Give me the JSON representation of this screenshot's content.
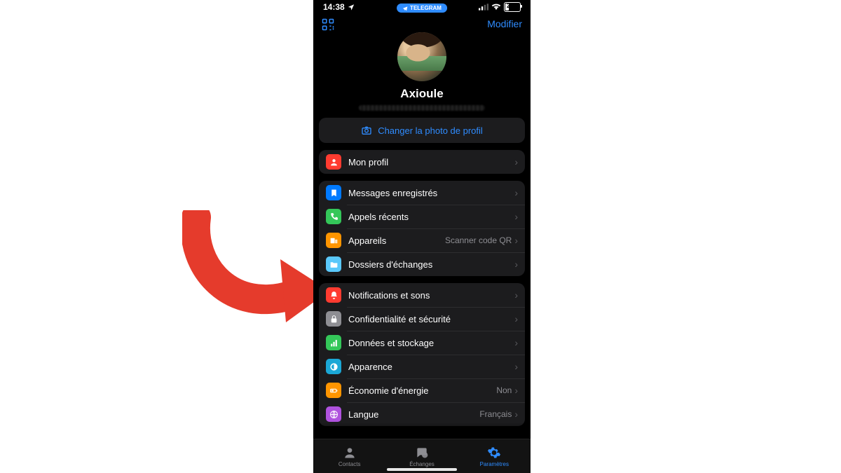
{
  "status": {
    "time": "14:38",
    "app_pill": "TELEGRAM",
    "battery": "23"
  },
  "header": {
    "modify": "Modifier"
  },
  "profile": {
    "name": "Axioule",
    "change_photo": "Changer la photo de profil"
  },
  "sections": {
    "my_profile": {
      "label": "Mon profil",
      "icon_color": "#ff3b30"
    },
    "group1": [
      {
        "name": "saved-messages",
        "label": "Messages enregistrés",
        "icon_color": "#007aff",
        "icon": "bookmark"
      },
      {
        "name": "recent-calls",
        "label": "Appels récents",
        "icon_color": "#34c759",
        "icon": "phone"
      },
      {
        "name": "devices",
        "label": "Appareils",
        "value": "Scanner code QR",
        "icon_color": "#ff9500",
        "icon": "devices"
      },
      {
        "name": "chat-folders",
        "label": "Dossiers d'échanges",
        "icon_color": "#5ac8fa",
        "icon": "folder"
      }
    ],
    "group2": [
      {
        "name": "notifications",
        "label": "Notifications et sons",
        "icon_color": "#ff3b30",
        "icon": "bell"
      },
      {
        "name": "privacy",
        "label": "Confidentialité et sécurité",
        "icon_color": "#8e8e93",
        "icon": "lock"
      },
      {
        "name": "data-storage",
        "label": "Données et stockage",
        "icon_color": "#34c759",
        "icon": "data"
      },
      {
        "name": "appearance",
        "label": "Apparence",
        "icon_color": "#1ba8d6",
        "icon": "circle"
      },
      {
        "name": "power-saving",
        "label": "Économie d'énergie",
        "value": "Non",
        "icon_color": "#ff9500",
        "icon": "battery"
      },
      {
        "name": "language",
        "label": "Langue",
        "value": "Français",
        "icon_color": "#af52de",
        "icon": "globe"
      }
    ]
  },
  "tabs": {
    "contacts": "Contacts",
    "chats": "Échanges",
    "settings": "Paramètres"
  }
}
